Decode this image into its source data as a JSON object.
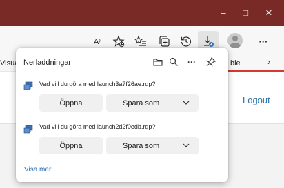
{
  "window": {
    "minimize_glyph": "–",
    "maximize_glyph": "□",
    "close_glyph": "✕"
  },
  "toolbar": {
    "read_aloud_label": "A⁾",
    "icons": [
      "read-aloud",
      "add-favorite",
      "favorites",
      "collections",
      "history",
      "downloads",
      "profile",
      "more"
    ],
    "more_label": "···"
  },
  "favorites_bar": {
    "left_fragment": "Visua",
    "right_fragment": "ble",
    "chevron": "›"
  },
  "page": {
    "logout_label": "Logout",
    "accent_color": "#d23b2e"
  },
  "downloads_panel": {
    "title": "Nerladdningar",
    "items": [
      {
        "prompt": "Vad vill du göra med launch3a7f26ae.rdp?",
        "open_label": "Öppna",
        "save_as_label": "Spara som"
      },
      {
        "prompt": "Vad vill du göra med launch2d2f0edb.rdp?",
        "open_label": "Öppna",
        "save_as_label": "Spara som"
      }
    ],
    "more_label": "···",
    "show_more_label": "Visa mer"
  }
}
